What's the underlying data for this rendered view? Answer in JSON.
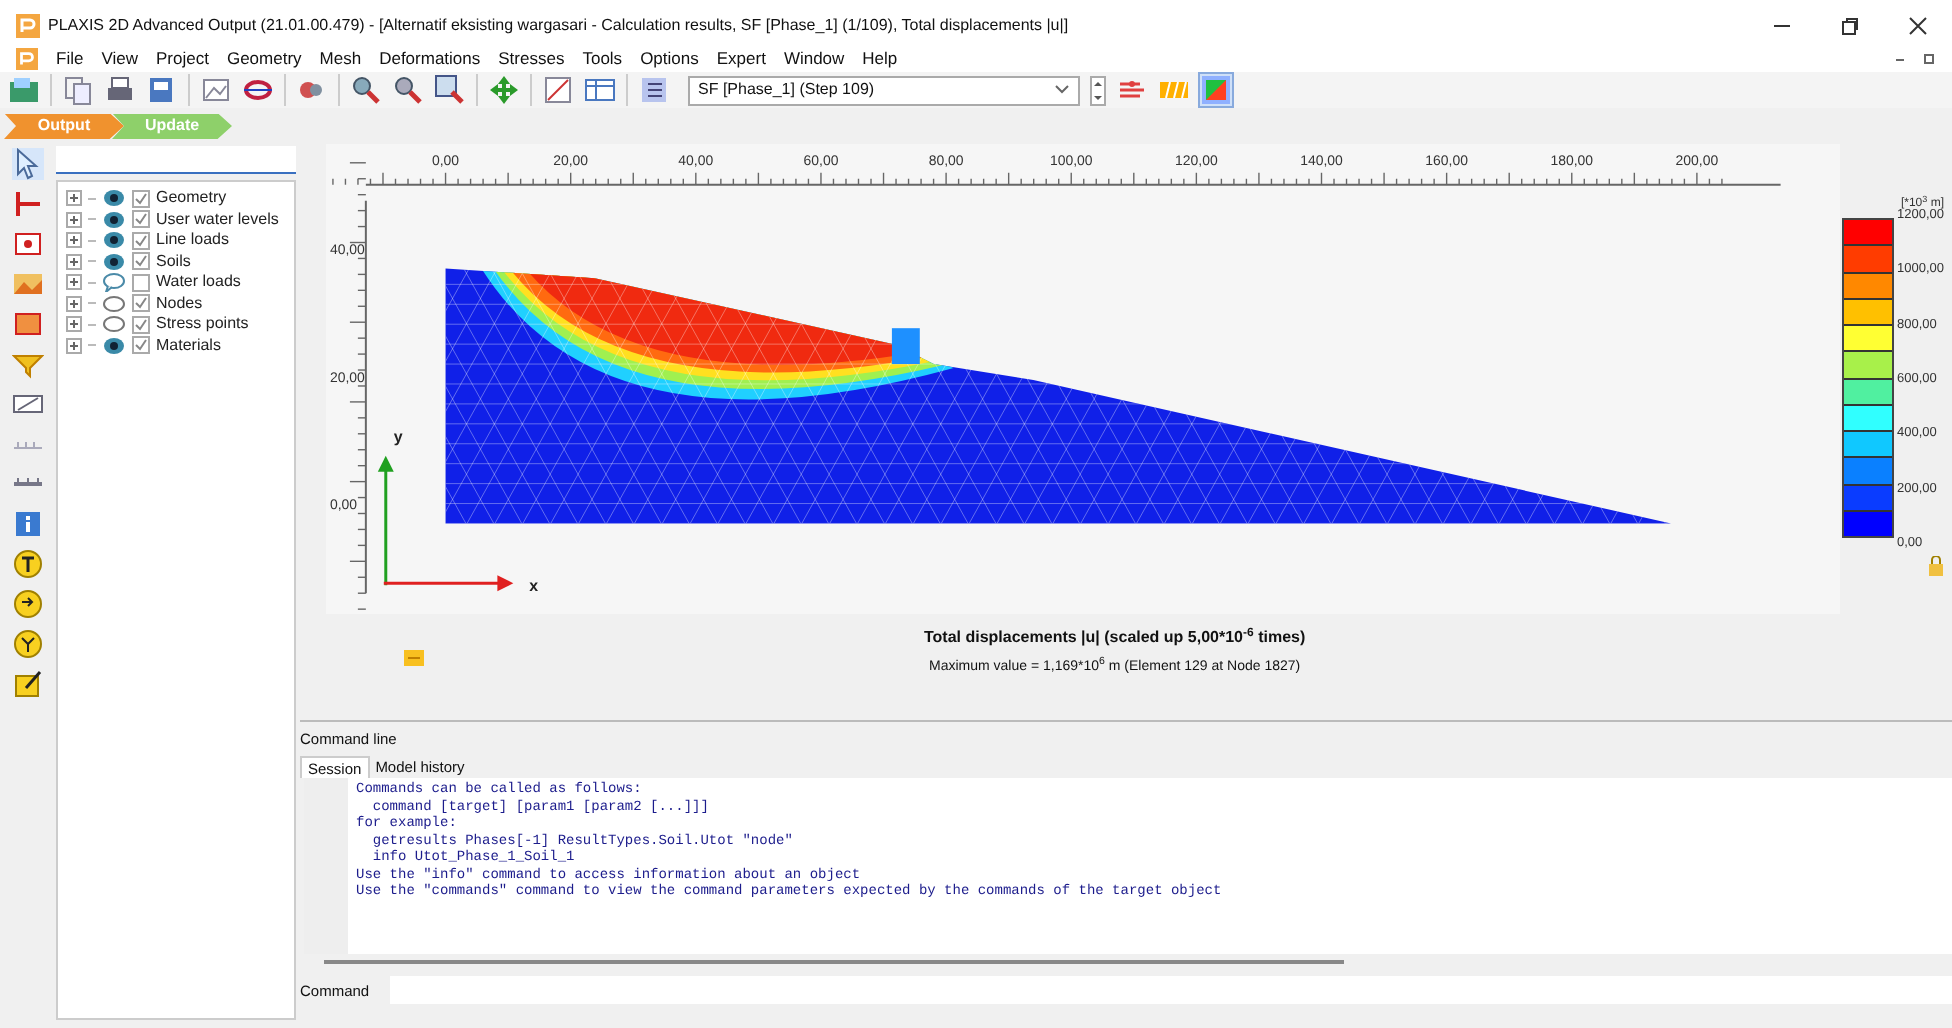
{
  "window": {
    "title": "PLAXIS 2D Advanced Output (21.01.00.479) - [Alternatif eksisting wargasari - Calculation results, SF [Phase_1] (1/109), Total displacements |u|]"
  },
  "menu": [
    "File",
    "View",
    "Project",
    "Geometry",
    "Mesh",
    "Deformations",
    "Stresses",
    "Tools",
    "Options",
    "Expert",
    "Window",
    "Help"
  ],
  "toolbar": {
    "step_select": {
      "value": "SF [Phase_1] (Step 109)"
    }
  },
  "mode_tabs": [
    {
      "label": "Output",
      "selected": true
    },
    {
      "label": "Update",
      "selected": false
    }
  ],
  "tree": {
    "items": [
      {
        "label": "Geometry",
        "kind": "eye",
        "checked": true
      },
      {
        "label": "User water levels",
        "kind": "eye",
        "checked": true
      },
      {
        "label": "Line loads",
        "kind": "eye",
        "checked": true
      },
      {
        "label": "Soils",
        "kind": "eye",
        "checked": true
      },
      {
        "label": "Water loads",
        "kind": "bubble",
        "checked": false
      },
      {
        "label": "Nodes",
        "kind": "ellipse",
        "checked": true
      },
      {
        "label": "Stress points",
        "kind": "ellipse",
        "checked": true
      },
      {
        "label": "Materials",
        "kind": "eye",
        "checked": true
      }
    ]
  },
  "plot": {
    "x_ruler": [
      "0,00",
      "20,00",
      "40,00",
      "60,00",
      "80,00",
      "100,00",
      "120,00",
      "140,00",
      "160,00",
      "180,00",
      "200,00"
    ],
    "y_ruler": [
      "40,00",
      "20,00",
      "0,00"
    ],
    "axis_labels": [
      "y",
      "x"
    ],
    "legend": {
      "unit": "[*10$^{3}$ m]",
      "labels": [
        "1200,00",
        "1000,00",
        "800,00",
        "600,00",
        "400,00",
        "200,00",
        "0,00"
      ],
      "bands": [
        {
          "color": "#ff0000"
        },
        {
          "color": "#ff3c00"
        },
        {
          "color": "#ff8800"
        },
        {
          "color": "#ffc000"
        },
        {
          "color": "#ffff33"
        },
        {
          "color": "#a8f04a"
        },
        {
          "color": "#50f0a0"
        },
        {
          "color": "#30ffff"
        },
        {
          "color": "#10c8ff"
        },
        {
          "color": "#0a80ff"
        },
        {
          "color": "#0a3cff"
        },
        {
          "color": "#0000ff"
        }
      ]
    },
    "caption": {
      "title": "Total displacements |u| (scaled up 5,00*10$^{-6}$ times)",
      "subtitle": "Maximum value = 1,169*10$^{6}$ m (Element 129 at Node 1827)"
    }
  },
  "command_line": {
    "title": "Command line",
    "tabs": [
      {
        "label": "Session",
        "selected": true
      },
      {
        "label": "Model history",
        "selected": false
      }
    ],
    "output_lines": [
      "Commands can be called as follows:",
      "  command [target] [param1 [param2 [...]]]",
      "for example:",
      "  getresults Phases[-1] ResultTypes.Soil.Utot \"node\"",
      "  info Utot_Phase_1_Soil_1",
      "Use the \"info\" command to access information about an object",
      "Use the \"commands\" command to view the command parameters expected by the commands of the target object"
    ],
    "input_label": "Command"
  }
}
